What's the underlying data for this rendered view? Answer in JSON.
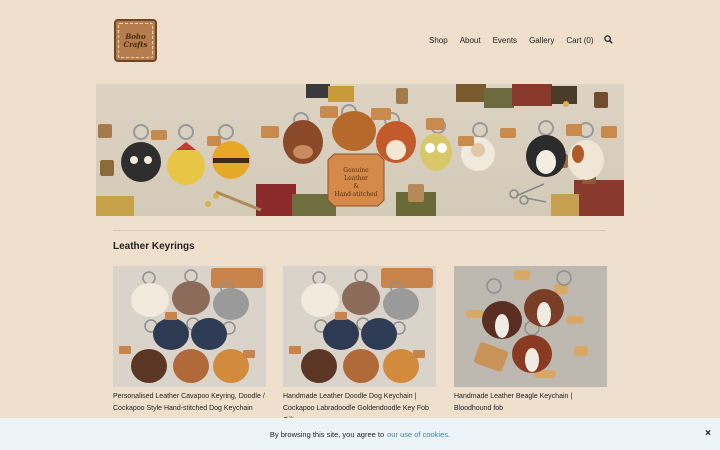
{
  "brand": {
    "logo_text_line1": "Boho",
    "logo_text_line2": "Crafts",
    "logo_color": "#b57d4d"
  },
  "nav": {
    "items": [
      {
        "label": "Shop"
      },
      {
        "label": "About"
      },
      {
        "label": "Events"
      },
      {
        "label": "Gallery"
      },
      {
        "label": "Cart (0)"
      }
    ],
    "search_icon": "search-icon"
  },
  "banner": {
    "tag_line1": "Genuine",
    "tag_line2": "Leather",
    "tag_line3": "&",
    "tag_line4": "Hand-stitched"
  },
  "section": {
    "title": "Leather Keyrings"
  },
  "products": [
    {
      "title": "Personalised Leather Cavapoo Keyring, Doodle / Cockapoo Style Hand-stitched Dog Keychain"
    },
    {
      "title": "Handmade Leather Doodle Dog Keychain | Cockapoo Labradoodle Goldendoodle Key Fob Gift"
    },
    {
      "title": "Handmade Leather Beagle Keychain | Bloodhound fob"
    }
  ],
  "cookie": {
    "text": "By browsing this site, you agree to",
    "link": "our use of cookies.",
    "close": "×"
  },
  "colors": {
    "background": "#efe0cd",
    "cookie_bar": "#edf4f7",
    "link": "#3b7ea8"
  }
}
